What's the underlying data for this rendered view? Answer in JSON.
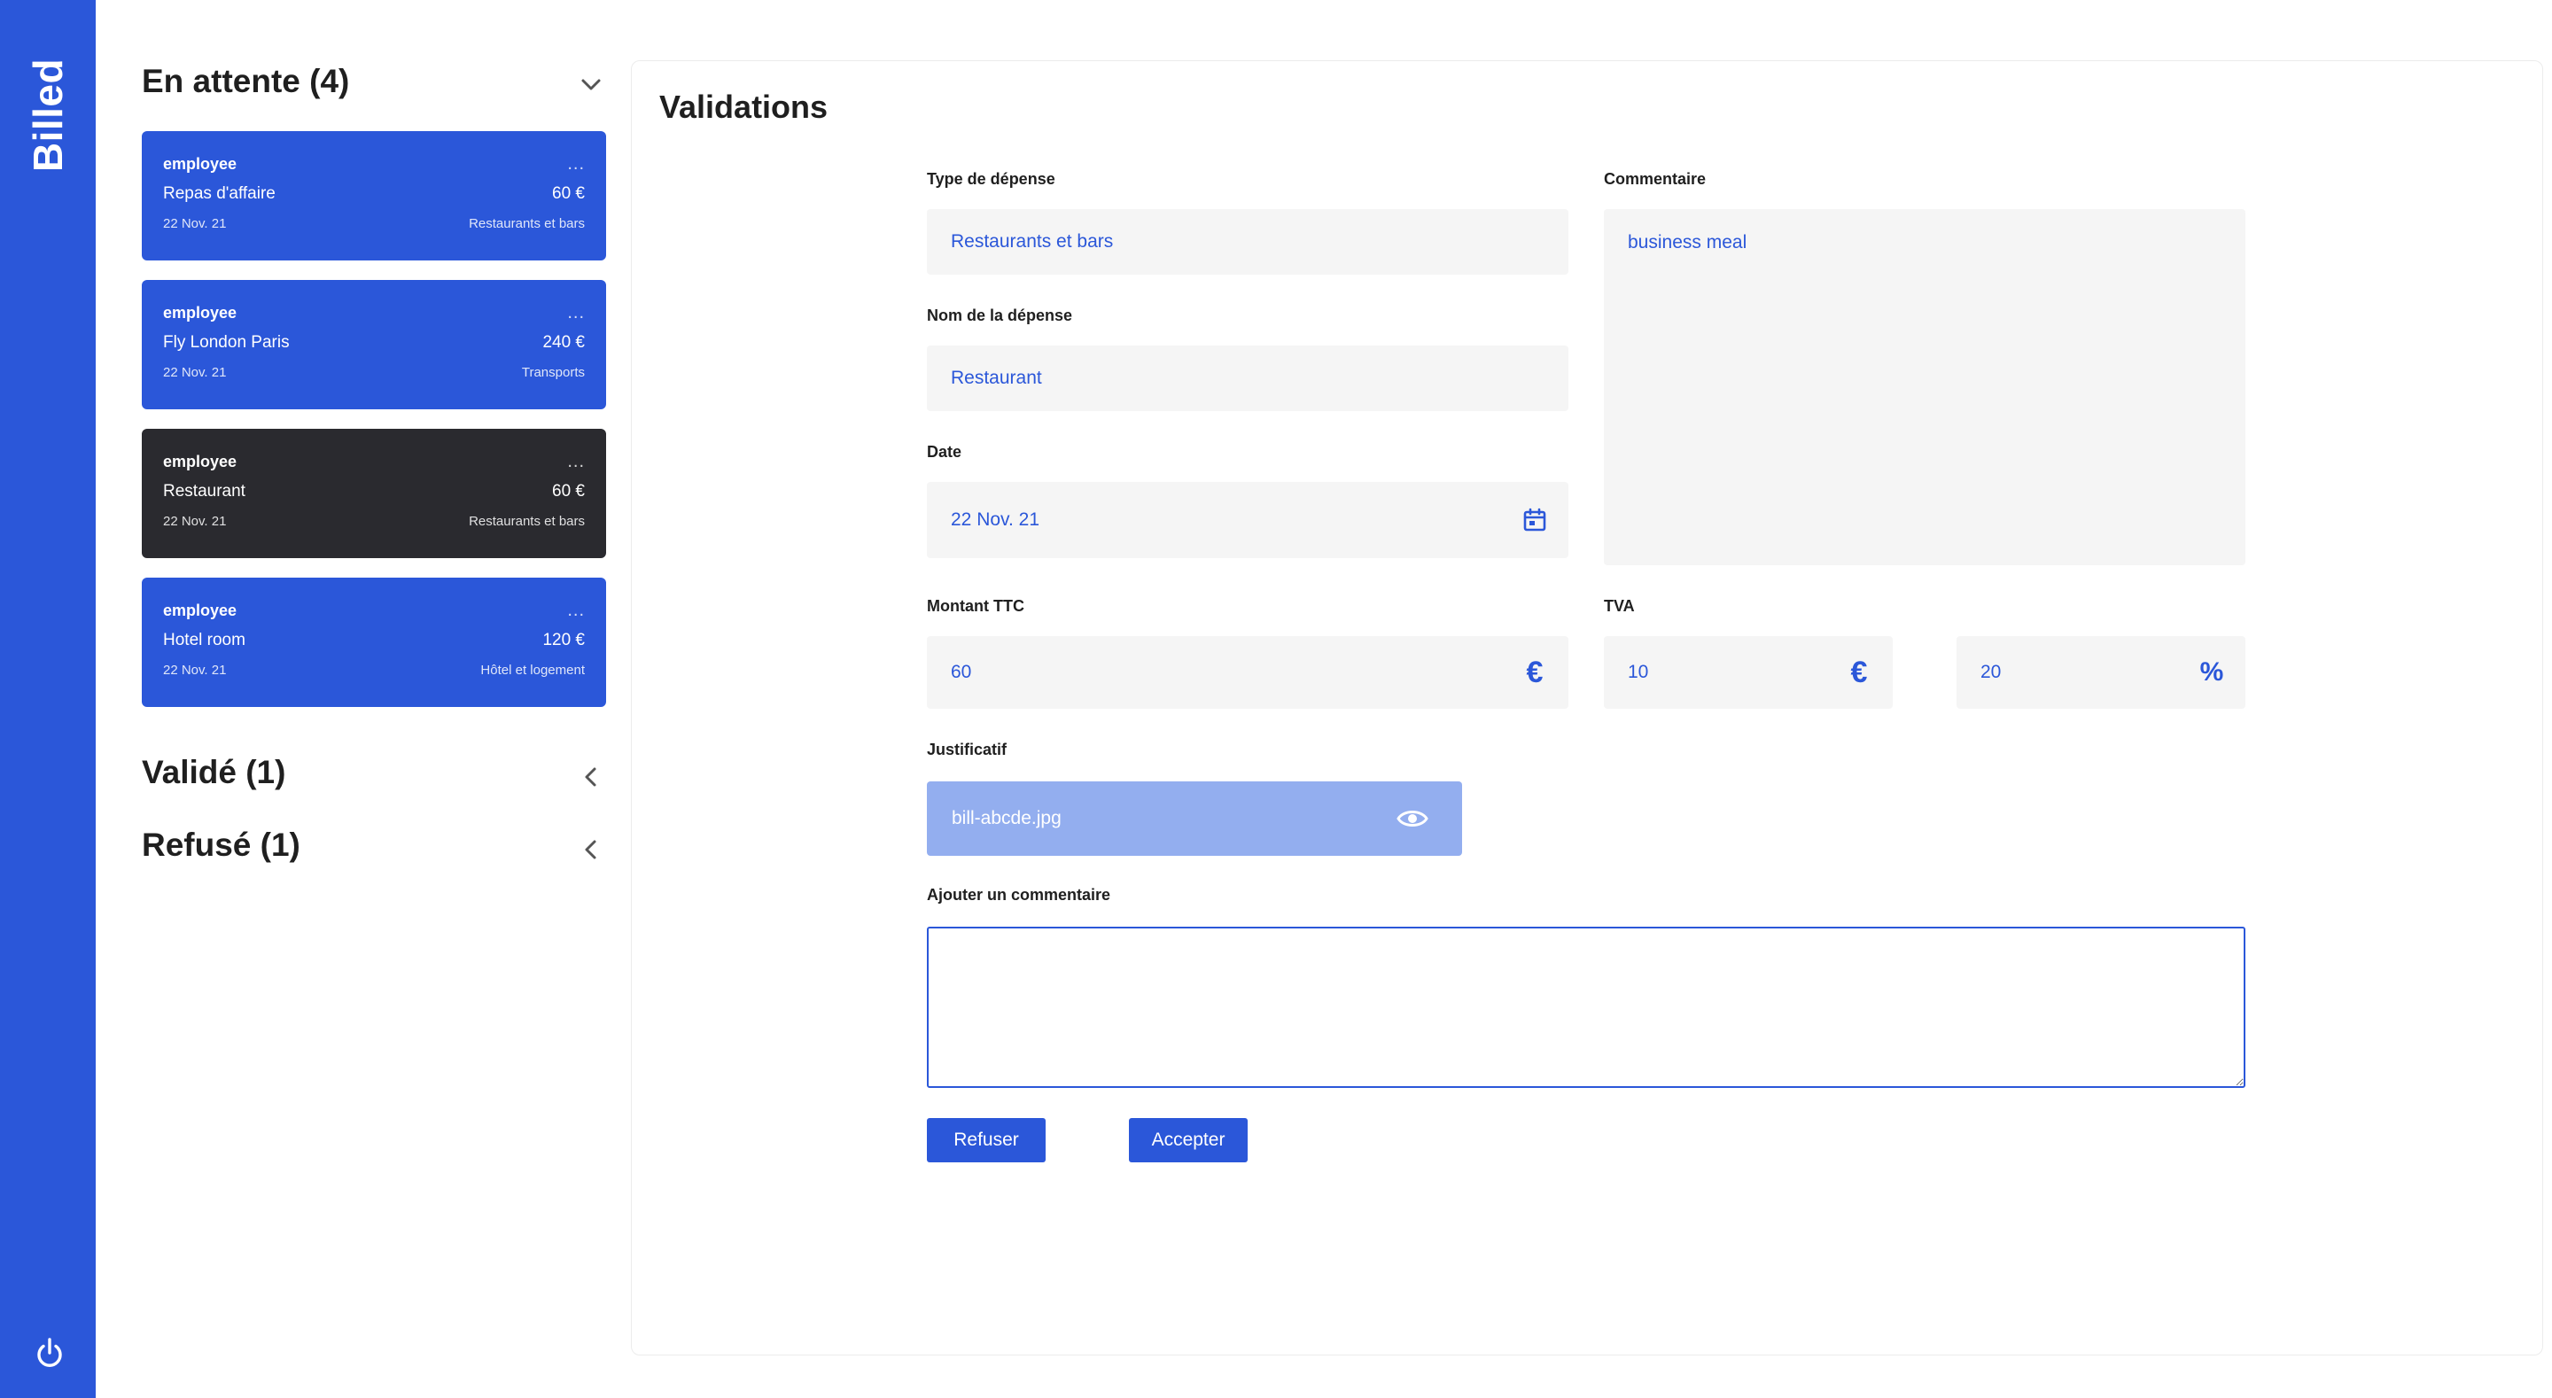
{
  "app": {
    "brand": "Billed"
  },
  "colors": {
    "primary": "#2b57d9",
    "active_card": "#2a2a2f",
    "file_box": "#93aeef",
    "field_bg": "#f5f5f5"
  },
  "sections": [
    {
      "title": "En attente (4)",
      "state": "expanded",
      "icon": "chevron-down-icon"
    },
    {
      "title": "Validé (1)",
      "state": "collapsed",
      "icon": "chevron-left-icon"
    },
    {
      "title": "Refusé (1)",
      "state": "collapsed",
      "icon": "chevron-left-icon"
    }
  ],
  "bills": [
    {
      "email": "employee",
      "dots": "...",
      "name": "Repas d'affaire",
      "amount": "60 €",
      "date": "22 Nov. 21",
      "type": "Restaurants et bars",
      "active": false
    },
    {
      "email": "employee",
      "dots": "...",
      "name": "Fly London Paris",
      "amount": "240 €",
      "date": "22 Nov. 21",
      "type": "Transports",
      "active": false
    },
    {
      "email": "employee",
      "dots": "...",
      "name": "Restaurant",
      "amount": "60 €",
      "date": "22 Nov. 21",
      "type": "Restaurants et bars",
      "active": true
    },
    {
      "email": "employee",
      "dots": "...",
      "name": "Hotel room",
      "amount": "120 €",
      "date": "22 Nov. 21",
      "type": "Hôtel et logement",
      "active": false
    }
  ],
  "panel": {
    "title": "Validations",
    "expense_type": {
      "label": "Type de dépense",
      "value": "Restaurants et bars"
    },
    "expense_name": {
      "label": "Nom de la dépense",
      "value": "Restaurant"
    },
    "date": {
      "label": "Date",
      "value": "22 Nov. 21",
      "icon": "calendar-icon"
    },
    "comment": {
      "label": "Commentaire",
      "value": "business meal"
    },
    "amount": {
      "label": "Montant TTC",
      "value": "60",
      "unit": "€"
    },
    "vat": {
      "label": "TVA",
      "value": "10",
      "unit": "€",
      "pct_value": "20",
      "pct_unit": "%"
    },
    "proof": {
      "label": "Justificatif",
      "file": "bill-abcde.jpg",
      "icon": "eye-icon"
    },
    "add_comment": {
      "label": "Ajouter un commentaire",
      "value": ""
    },
    "buttons": {
      "refuse": "Refuser",
      "accept": "Accepter"
    }
  }
}
